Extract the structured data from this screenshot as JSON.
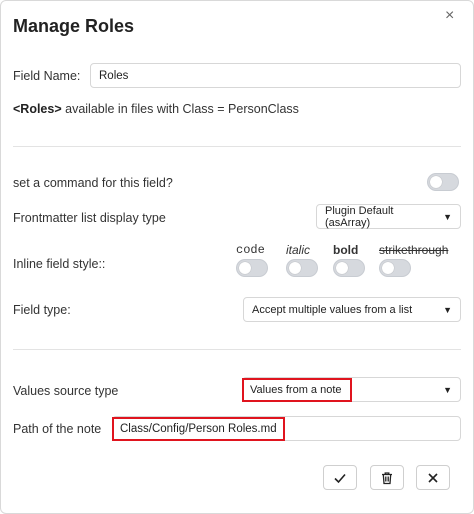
{
  "dialog": {
    "title": "Manage Roles",
    "close_glyph": "×"
  },
  "field_name": {
    "label": "Field Name:",
    "value": "Roles"
  },
  "info": {
    "field": "<Roles>",
    "text": " available in files with Class = PersonClass"
  },
  "command": {
    "label": "set a command for this field?",
    "enabled": false
  },
  "frontmatter": {
    "label": "Frontmatter list display type",
    "selected": "Plugin Default (asArray)"
  },
  "inline_style": {
    "label": "Inline field style::",
    "options": [
      {
        "name": "code",
        "enabled": false
      },
      {
        "name": "italic",
        "enabled": false
      },
      {
        "name": "bold",
        "enabled": false
      },
      {
        "name": "strikethrough",
        "enabled": false
      }
    ]
  },
  "field_type": {
    "label": "Field type:",
    "selected": "Accept multiple values from a list"
  },
  "values_source": {
    "label": "Values source type",
    "selected": "Values from a note"
  },
  "note_path": {
    "label": "Path of the note",
    "value": "Class/Config/Person Roles.md"
  },
  "actions": {
    "icons": [
      "check-icon",
      "trash-icon",
      "close-icon"
    ]
  },
  "colors": {
    "highlight": "#e0141e",
    "toggle_off": "#d6d9de"
  }
}
